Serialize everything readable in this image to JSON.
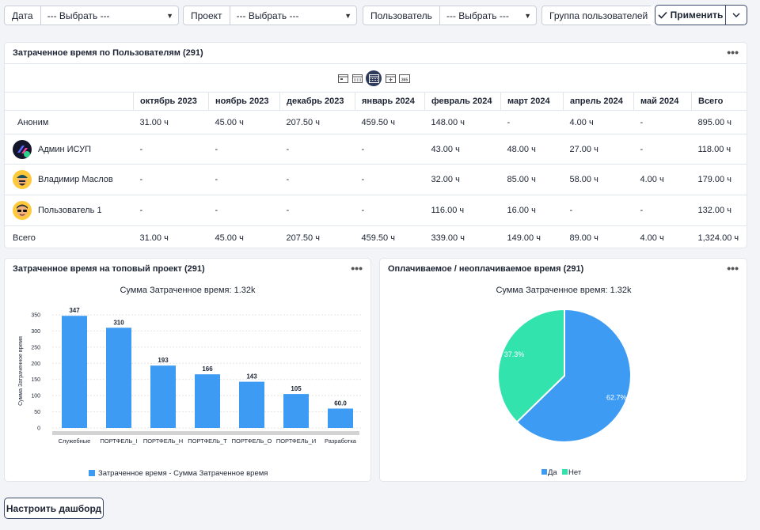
{
  "filters": [
    {
      "label": "Дата",
      "value": "--- Выбрать ---"
    },
    {
      "label": "Проект",
      "value": "--- Выбрать ---"
    },
    {
      "label": "Пользователь",
      "value": "--- Выбрать ---"
    },
    {
      "label": "Группа пользователей",
      "value": ""
    }
  ],
  "apply_label": "Применить",
  "table_card": {
    "title": "Затраченное время по Пользователям (291)",
    "view_icons": [
      "calendar-day-icon",
      "calendar-week-icon",
      "calendar-month-icon",
      "calendar-quarter-icon",
      "calendar-year-icon"
    ],
    "columns": [
      "",
      "октябрь 2023",
      "ноябрь 2023",
      "декабрь 2023",
      "январь 2024",
      "февраль 2024",
      "март 2024",
      "апрель 2024",
      "май 2024",
      "Всего"
    ],
    "rows": [
      {
        "user": "Аноним",
        "avatar": "none",
        "values": [
          "31.00 ч",
          "45.00 ч",
          "207.50 ч",
          "459.50 ч",
          "148.00 ч",
          "-",
          "4.00 ч",
          "-",
          "895.00 ч"
        ]
      },
      {
        "user": "Админ ИСУП",
        "avatar": "logo",
        "values": [
          "-",
          "-",
          "-",
          "-",
          "43.00 ч",
          "48.00 ч",
          "27.00 ч",
          "-",
          "118.00 ч"
        ]
      },
      {
        "user": "Владимир Маслов",
        "avatar": "person-hat",
        "values": [
          "-",
          "-",
          "-",
          "-",
          "32.00 ч",
          "85.00 ч",
          "58.00 ч",
          "4.00 ч",
          "179.00 ч"
        ]
      },
      {
        "user": "Пользователь 1",
        "avatar": "person-glasses",
        "values": [
          "-",
          "-",
          "-",
          "-",
          "116.00 ч",
          "16.00 ч",
          "-",
          "-",
          "132.00 ч"
        ]
      }
    ],
    "total": {
      "label": "Всего",
      "values": [
        "31.00 ч",
        "45.00 ч",
        "207.50 ч",
        "459.50 ч",
        "339.00 ч",
        "149.00 ч",
        "89.00 ч",
        "4.00 ч",
        "1,324.00 ч"
      ]
    }
  },
  "bar_card": {
    "title": "Затраченное время на топовый проект (291)"
  },
  "pie_card": {
    "title": "Оплачиваемое / неоплачиваемое время (291)"
  },
  "setup_label": "Настроить дашборд",
  "chart_data": [
    {
      "type": "bar",
      "title": "Сумма Затраченное время: 1.32k",
      "ylabel": "Сумма Затраченное время",
      "categories": [
        "Служебные",
        "ПОРТФЕЛЬ_I",
        "ПОРТФЕЛЬ_Н",
        "ПОРТФЕЛЬ_Т",
        "ПОРТФЕЛЬ_О",
        "ПОРТФЕЛЬ_И",
        "Разработка"
      ],
      "data_labels": [
        "347",
        "310",
        "193",
        "166",
        "143",
        "105",
        "60.0"
      ],
      "values": [
        347,
        310,
        193,
        166,
        143,
        105,
        60
      ],
      "ylim": [
        0,
        350
      ],
      "yticks": [
        "0",
        "50",
        "100",
        "150",
        "200",
        "250",
        "300",
        "350"
      ],
      "series": [
        {
          "name": "Затраченное время - Сумма Затраченное время",
          "values": [
            347,
            310,
            193,
            166,
            143,
            105,
            60
          ]
        }
      ],
      "color": "#3d9bf3",
      "legend": "bottom",
      "grid": true
    },
    {
      "type": "pie",
      "title": "Сумма Затраченное время: 1.32k",
      "labels": [
        "Да",
        "Нет"
      ],
      "values": [
        62.7,
        37.3
      ],
      "data_labels": [
        "62.7%",
        "37.3%"
      ],
      "colors": [
        "#3d9bf3",
        "#33e3ae"
      ],
      "legend": "bottom"
    }
  ]
}
